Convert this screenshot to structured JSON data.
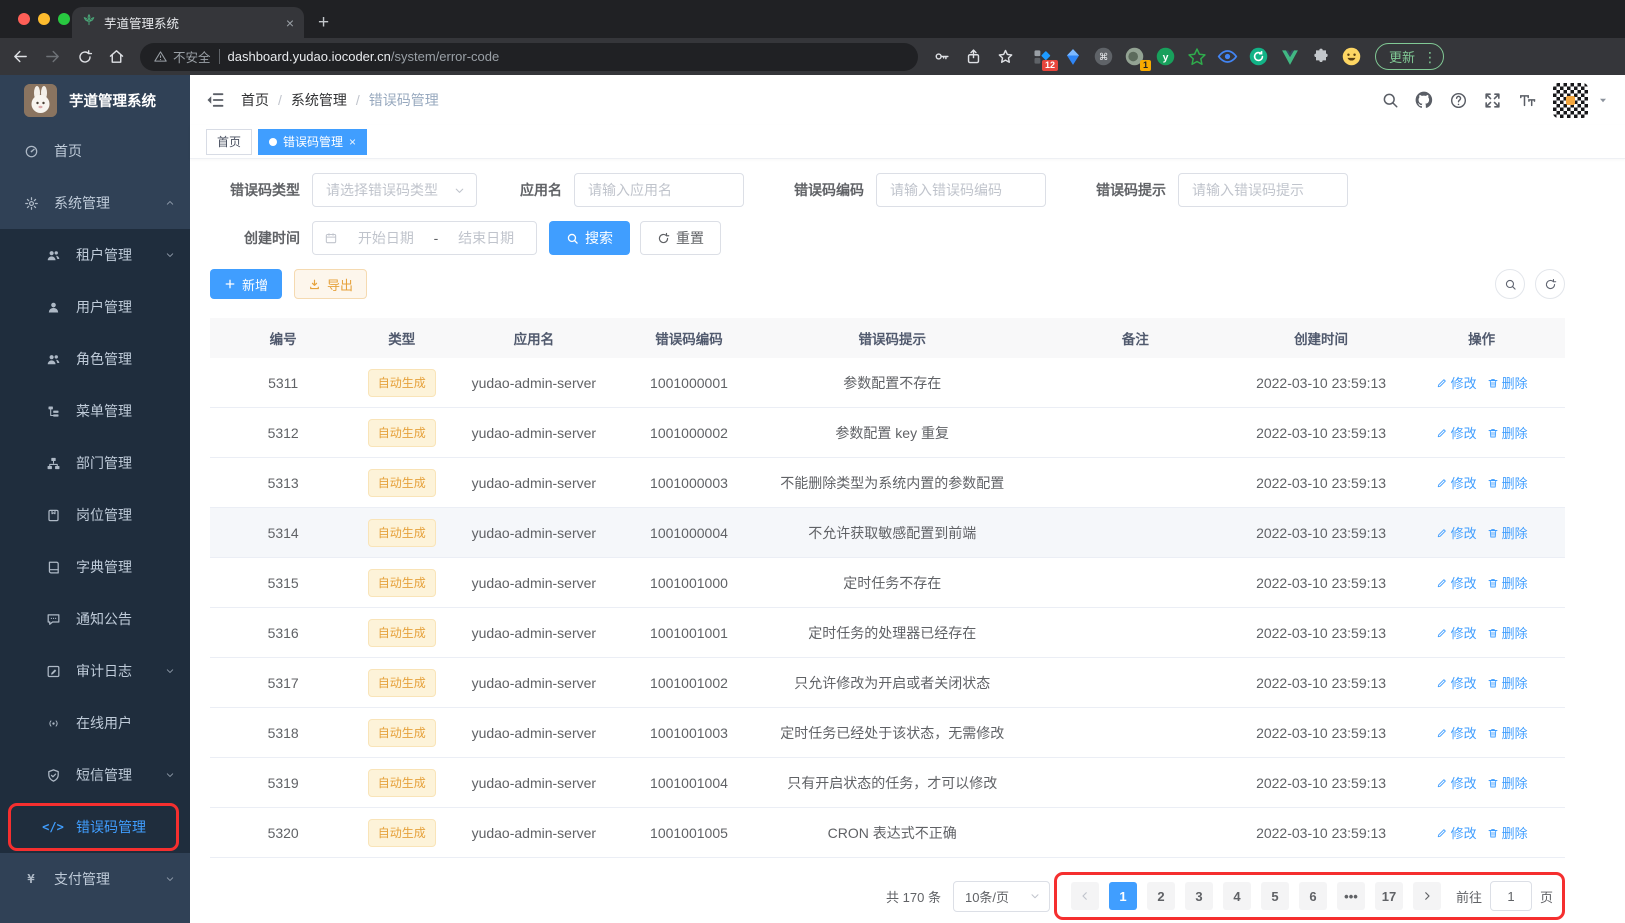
{
  "colors": {
    "accent": "#409eff",
    "warning_text": "#e6a23c",
    "annotation_red": "#f52f2f",
    "sidebar_bg": "#304156",
    "submenu_bg": "#1f2d3d"
  },
  "browser": {
    "tab": {
      "title": "芋道管理系统"
    },
    "address": {
      "security": "不安全",
      "domain": "dashboard.yudao.iocoder.cn",
      "path": "/system/error-code"
    },
    "extensions": [
      {
        "kind": "squares",
        "badge": "12"
      },
      {
        "kind": "kite"
      },
      {
        "kind": "command"
      },
      {
        "kind": "dot",
        "badge": "1"
      },
      {
        "kind": "letter",
        "letter": "y",
        "color": "#1fae5e"
      },
      {
        "kind": "star"
      },
      {
        "kind": "eye"
      },
      {
        "kind": "refresh"
      },
      {
        "kind": "vue"
      },
      {
        "kind": "puzzle"
      },
      {
        "kind": "emoji"
      }
    ],
    "update_button": "更新"
  },
  "sidebar": {
    "app_title": "芋道管理系统",
    "menu": [
      {
        "label": "首页",
        "icon": "dashboard-icon",
        "level": 1
      },
      {
        "label": "系统管理",
        "icon": "gear-icon",
        "level": 1,
        "chevron": "up"
      },
      {
        "label": "租户管理",
        "icon": "tenant-users-icon",
        "level": 2,
        "chevron": "down"
      },
      {
        "label": "用户管理",
        "icon": "user-icon",
        "level": 2
      },
      {
        "label": "角色管理",
        "icon": "roles-icon",
        "level": 2
      },
      {
        "label": "菜单管理",
        "icon": "menu-tree-icon",
        "level": 2
      },
      {
        "label": "部门管理",
        "icon": "department-tree-icon",
        "level": 2
      },
      {
        "label": "岗位管理",
        "icon": "post-badge-icon",
        "level": 2
      },
      {
        "label": "字典管理",
        "icon": "dictionary-book-icon",
        "level": 2
      },
      {
        "label": "通知公告",
        "icon": "announcement-icon",
        "level": 2
      },
      {
        "label": "审计日志",
        "icon": "audit-log-icon",
        "level": 2,
        "chevron": "down"
      },
      {
        "label": "在线用户",
        "icon": "online-users-icon",
        "level": 2
      },
      {
        "label": "短信管理",
        "icon": "sms-shield-icon",
        "level": 2,
        "chevron": "down"
      },
      {
        "label": "错误码管理",
        "icon": "error-code-icon",
        "level": 2,
        "active": true,
        "annotated": true
      },
      {
        "label": "支付管理",
        "icon": "payment-yen-icon",
        "level": 1,
        "chevron": "down"
      }
    ]
  },
  "header": {
    "breadcrumb": [
      "首页",
      "系统管理",
      "错误码管理"
    ]
  },
  "tags": [
    {
      "label": "首页",
      "active": false
    },
    {
      "label": "错误码管理",
      "active": true,
      "closable": true
    }
  ],
  "filters": {
    "type_label": "错误码类型",
    "type_placeholder": "请选择错误码类型",
    "app_label": "应用名",
    "app_placeholder": "请输入应用名",
    "code_label": "错误码编码",
    "code_placeholder": "请输入错误码编码",
    "hint_label": "错误码提示",
    "hint_placeholder": "请输入错误码提示",
    "date_label": "创建时间",
    "date_start": "开始日期",
    "date_separator": "-",
    "date_end": "结束日期",
    "search_button": "搜索",
    "reset_button": "重置"
  },
  "toolbar": {
    "add_button": "新增",
    "export_button": "导出"
  },
  "table": {
    "headers": [
      "编号",
      "类型",
      "应用名",
      "错误码编码",
      "错误码提示",
      "备注",
      "创建时间",
      "操作"
    ],
    "edit_label": "修改",
    "delete_label": "删除",
    "rows": [
      {
        "id": "5311",
        "type": "自动生成",
        "app": "yudao-admin-server",
        "code": "1001000001",
        "message": "参数配置不存在",
        "remark": "",
        "created": "2022-03-10 23:59:13"
      },
      {
        "id": "5312",
        "type": "自动生成",
        "app": "yudao-admin-server",
        "code": "1001000002",
        "message": "参数配置 key 重复",
        "remark": "",
        "created": "2022-03-10 23:59:13"
      },
      {
        "id": "5313",
        "type": "自动生成",
        "app": "yudao-admin-server",
        "code": "1001000003",
        "message": "不能删除类型为系统内置的参数配置",
        "remark": "",
        "created": "2022-03-10 23:59:13"
      },
      {
        "id": "5314",
        "type": "自动生成",
        "app": "yudao-admin-server",
        "code": "1001000004",
        "message": "不允许获取敏感配置到前端",
        "remark": "",
        "created": "2022-03-10 23:59:13",
        "highlighted": true
      },
      {
        "id": "5315",
        "type": "自动生成",
        "app": "yudao-admin-server",
        "code": "1001001000",
        "message": "定时任务不存在",
        "remark": "",
        "created": "2022-03-10 23:59:13"
      },
      {
        "id": "5316",
        "type": "自动生成",
        "app": "yudao-admin-server",
        "code": "1001001001",
        "message": "定时任务的处理器已经存在",
        "remark": "",
        "created": "2022-03-10 23:59:13"
      },
      {
        "id": "5317",
        "type": "自动生成",
        "app": "yudao-admin-server",
        "code": "1001001002",
        "message": "只允许修改为开启或者关闭状态",
        "remark": "",
        "created": "2022-03-10 23:59:13"
      },
      {
        "id": "5318",
        "type": "自动生成",
        "app": "yudao-admin-server",
        "code": "1001001003",
        "message": "定时任务已经处于该状态，无需修改",
        "remark": "",
        "created": "2022-03-10 23:59:13"
      },
      {
        "id": "5319",
        "type": "自动生成",
        "app": "yudao-admin-server",
        "code": "1001001004",
        "message": "只有开启状态的任务，才可以修改",
        "remark": "",
        "created": "2022-03-10 23:59:13"
      },
      {
        "id": "5320",
        "type": "自动生成",
        "app": "yudao-admin-server",
        "code": "1001001005",
        "message": "CRON 表达式不正确",
        "remark": "",
        "created": "2022-03-10 23:59:13"
      }
    ]
  },
  "pagination": {
    "total": "共 170 条",
    "page_size": "10条/页",
    "pages": [
      "1",
      "2",
      "3",
      "4",
      "5",
      "6",
      "•••",
      "17"
    ],
    "active_page": "1",
    "goto_label": "前往",
    "goto_value": "1",
    "goto_unit": "页"
  }
}
